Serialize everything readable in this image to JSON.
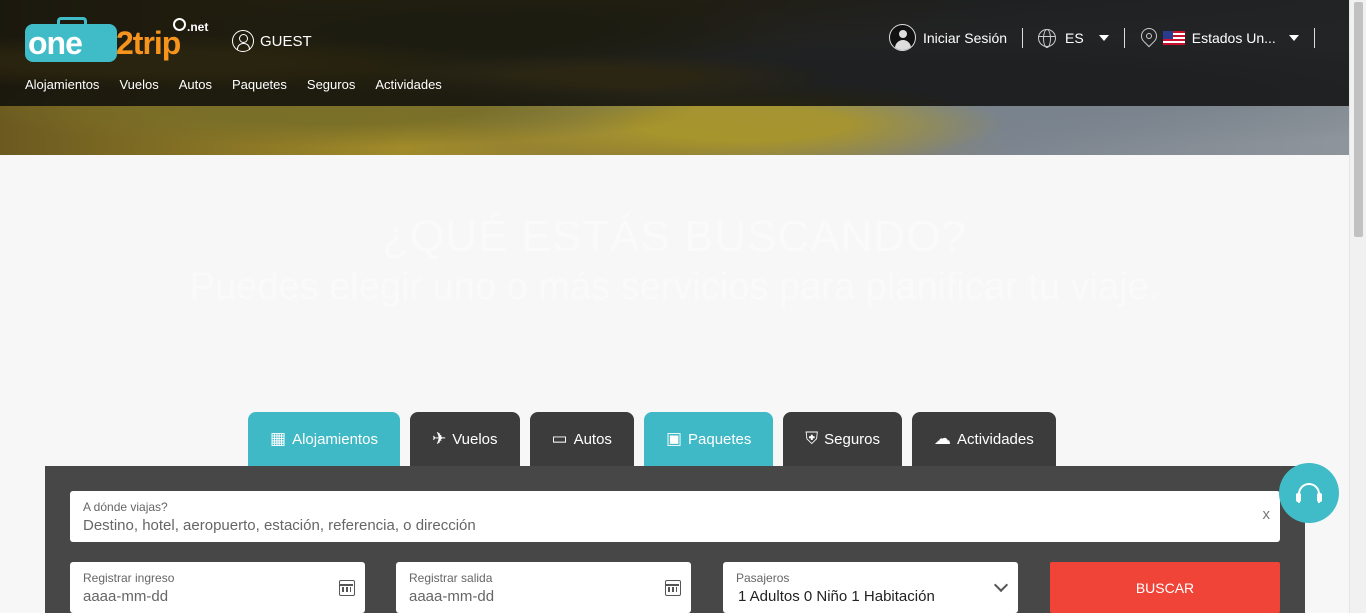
{
  "header": {
    "logo": {
      "main": "one",
      "number": "2",
      "suffix": "trip",
      "tld": ".net"
    },
    "guest_label": "GUEST",
    "nav": [
      "Alojamientos",
      "Vuelos",
      "Autos",
      "Paquetes",
      "Seguros",
      "Actividades"
    ],
    "login_label": "Iniciar Sesión",
    "language": "ES",
    "country": "Estados Un..."
  },
  "hero": {
    "title": "¿QUÉ ESTÁS BUSCANDO?",
    "subtitle": "Puedes elegir uno o más servicios para planificar tu viaje."
  },
  "tabs": [
    {
      "label": "Alojamientos",
      "icon": "building-icon",
      "active": true
    },
    {
      "label": "Vuelos",
      "icon": "plane-icon",
      "active": false
    },
    {
      "label": "Autos",
      "icon": "car-icon",
      "active": false
    },
    {
      "label": "Paquetes",
      "icon": "gift-icon",
      "active": true
    },
    {
      "label": "Seguros",
      "icon": "shield-icon",
      "active": false
    },
    {
      "label": "Actividades",
      "icon": "balloon-icon",
      "active": false
    }
  ],
  "search": {
    "destination_label": "A dónde viajas?",
    "destination_placeholder": "Destino, hotel, aeropuerto, estación, referencia, o dirección",
    "clear": "x",
    "checkin_label": "Registrar ingreso",
    "checkin_placeholder": "aaaa-mm-dd",
    "checkout_label": "Registrar salida",
    "checkout_placeholder": "aaaa-mm-dd",
    "passengers_label": "Pasajeros",
    "passengers_value": "1 Adultos 0 Niño  1 Habitación",
    "submit": "BUSCAR"
  },
  "colors": {
    "accent": "#3fbcc7",
    "orange": "#f7941d",
    "button": "#f04438",
    "panel": "#474747"
  }
}
